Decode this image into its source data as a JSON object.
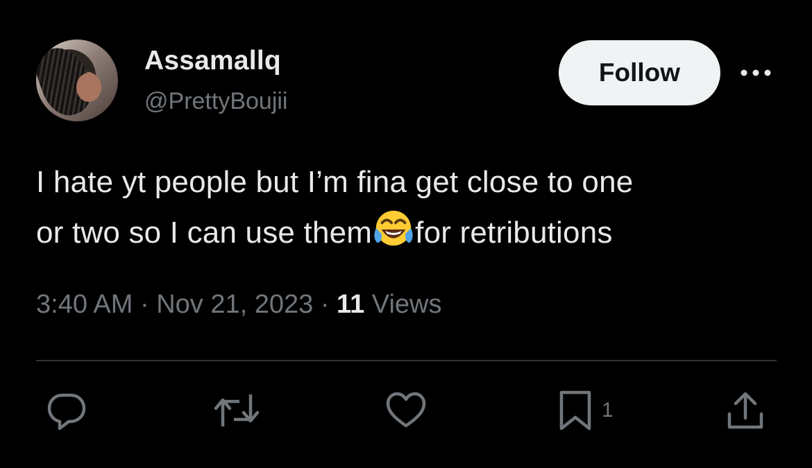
{
  "author": {
    "display_name": "Assamallq",
    "handle": "@PrettyBoujii"
  },
  "follow_button": {
    "label": "Follow"
  },
  "tweet": {
    "text_line_1": "I hate yt people but I’m fina get close to one",
    "text_line_2_before_emoji": "or two so I can use them",
    "emoji": "face-with-tears-of-joy",
    "text_line_2_after_emoji": "for retributions"
  },
  "meta": {
    "time": "3:40 AM",
    "separator": " · ",
    "date": "Nov 21, 2023",
    "views_count": "11",
    "views_label": "Views"
  },
  "actions": {
    "bookmark_count": "1"
  },
  "colors": {
    "background": "#000000",
    "primary_text": "#e7e9ea",
    "secondary_text": "#71767b",
    "divider": "#2f3336",
    "follow_bg": "#eff3f4"
  }
}
